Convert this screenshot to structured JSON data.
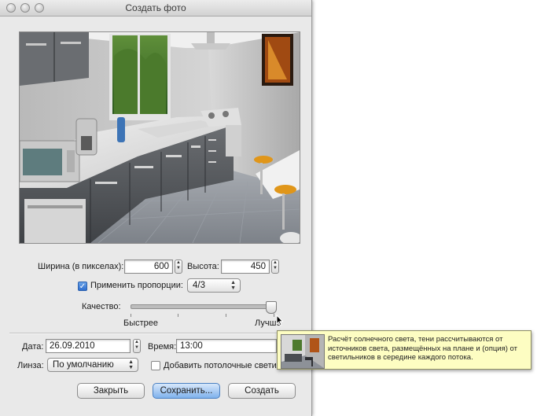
{
  "window": {
    "title": "Создать фото"
  },
  "size": {
    "width_label": "Ширина (в пикселах):",
    "width_value": "600",
    "height_label": "Высота:",
    "height_value": "450",
    "keep_proportions_label": "Применить пропорции:",
    "keep_proportions_checked": true,
    "ratio_value": "4/3"
  },
  "quality": {
    "label": "Качество:",
    "fast_label": "Быстрее",
    "best_label": "Лучше",
    "level": 1.0
  },
  "date": {
    "label": "Дата:",
    "value": "26.09.2010"
  },
  "time": {
    "label": "Время:",
    "value": "13:00"
  },
  "lens": {
    "label": "Линза:",
    "value": "По умолчанию"
  },
  "ceiling_lights": {
    "label": "Добавить потолочные светил",
    "checked": false
  },
  "tooltip": {
    "text": "Расчёт солнечного света, тени рассчитываются от источников света, размещённых на плане и (опция) от светильников в середине каждого потока."
  },
  "buttons": {
    "close": "Закрыть",
    "save": "Сохранить...",
    "create": "Создать"
  },
  "icons": {
    "window_buttons": [
      "close-icon",
      "minimize-icon",
      "zoom-icon"
    ],
    "stepper": "stepper-arrows-icon",
    "popup": "popup-arrows-icon",
    "cursor": "mouse-pointer-icon"
  }
}
